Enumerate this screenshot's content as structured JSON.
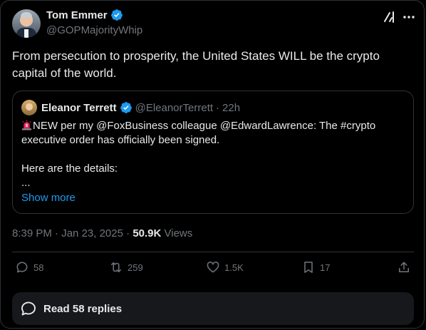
{
  "author": {
    "name": "Tom Emmer",
    "handle": "@GOPMajorityWhip"
  },
  "tweet": {
    "text": "From persecution to prosperity, the United States WILL be the crypto capital of the world."
  },
  "quote": {
    "name": "Eleanor Terrett",
    "handle": "@EleanorTerrett",
    "separator": "·",
    "age": "22h",
    "lines": [
      "NEW per my @FoxBusiness colleague @EdwardLawrence: The #crypto",
      "executive order has officially been signed.",
      "",
      "Here are the details:",
      "..."
    ],
    "show_more": "Show more"
  },
  "meta": {
    "time": "8:39 PM",
    "sep1": "·",
    "date": "Jan 23, 2025",
    "sep2": "·",
    "views_count": "50.9K",
    "views_label": "Views"
  },
  "actions": {
    "replies": "58",
    "reposts": "259",
    "likes": "1.5K",
    "bookmarks": "17"
  },
  "read_replies": "Read 58 replies",
  "colors": {
    "background": "#000000",
    "text": "#e7e9ea",
    "muted": "#71767b",
    "accent": "#1d9bf0",
    "border": "#2f3336"
  },
  "icons": [
    "verified-badge-icon",
    "grok-icon",
    "more-icon",
    "siren-icon",
    "reply-icon",
    "repost-icon",
    "like-icon",
    "bookmark-icon",
    "share-icon",
    "replies-bubble-icon"
  ]
}
